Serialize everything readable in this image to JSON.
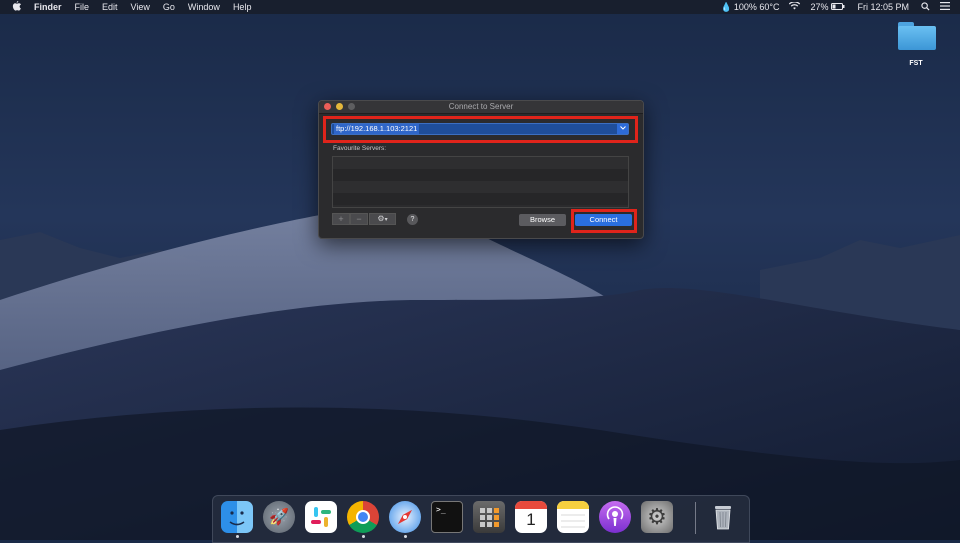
{
  "menubar": {
    "apple_icon": "apple-icon",
    "app_name": "Finder",
    "menus": [
      "File",
      "Edit",
      "View",
      "Go",
      "Window",
      "Help"
    ],
    "status_battery_temp": "100% 60°C",
    "battery_percent": "27%",
    "clock": "Fri 12:05 PM"
  },
  "desktop": {
    "folder_label": "FST"
  },
  "dialog": {
    "title": "Connect to Server",
    "server_address": "ftp://192.168.1.103:2121",
    "favourites_label": "Favourite Servers:",
    "add_label": "+",
    "remove_label": "−",
    "help_label": "?",
    "browse_label": "Browse",
    "connect_label": "Connect"
  },
  "dock": {
    "items": [
      "Finder",
      "Launchpad",
      "Slack",
      "Chrome",
      "Safari",
      "Terminal",
      "Calculator",
      "Calendar",
      "Notes",
      "Podcasts",
      "System Preferences",
      "Trash"
    ],
    "calendar_day": "1",
    "terminal_prompt": ">_"
  },
  "colors": {
    "highlight": "#e0241b",
    "accent": "#2a6fe0"
  }
}
